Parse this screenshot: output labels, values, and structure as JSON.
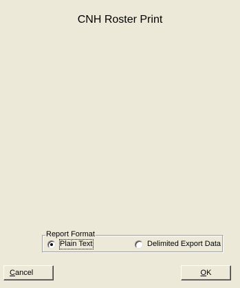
{
  "dialog": {
    "title": "CNH Roster Print"
  },
  "report_format": {
    "legend": "Report Format",
    "options": [
      {
        "label": "Plain Text",
        "checked": true
      },
      {
        "label": "Delimited Export Data",
        "checked": false
      }
    ]
  },
  "buttons": {
    "cancel": {
      "accel": "C",
      "rest": "ancel"
    },
    "ok": {
      "accel": "O",
      "rest": "K"
    }
  },
  "colors": {
    "dialog_background": "#ece9d8"
  }
}
